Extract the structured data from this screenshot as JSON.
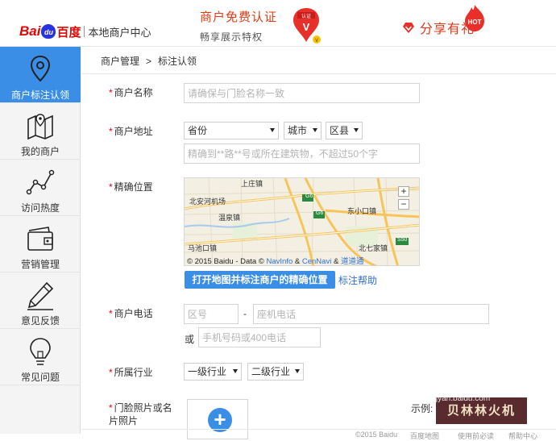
{
  "header": {
    "logo_bai": "Bai",
    "logo_du": "du",
    "logo_cn": "百度",
    "subtitle": "本地商户中心",
    "promo_line1": "商户免费认证",
    "promo_line2": "畅享展示特权",
    "promo_badge": "认证",
    "promo_badge_v": "V",
    "share_text": "分享有礼",
    "hot_badge": "HOT"
  },
  "sidebar": {
    "items": [
      {
        "label": "商户标注认领",
        "icon": "map-pin-icon",
        "active": true
      },
      {
        "label": "我的商户",
        "icon": "map-icon",
        "active": false
      },
      {
        "label": "访问热度",
        "icon": "line-chart-icon",
        "active": false
      },
      {
        "label": "营销管理",
        "icon": "wallet-icon",
        "active": false
      },
      {
        "label": "意见反馈",
        "icon": "pencil-icon",
        "active": false
      },
      {
        "label": "常见问题",
        "icon": "lightbulb-icon",
        "active": false
      }
    ]
  },
  "breadcrumb": {
    "root": "商户管理",
    "separator": ">",
    "current": "标注认领"
  },
  "form": {
    "name": {
      "label": "商户名称",
      "placeholder": "请确保与门脸名称一致"
    },
    "address": {
      "label": "商户地址",
      "province": "省份",
      "city": "城市",
      "district": "区县",
      "detail_placeholder": "精确到**路**号或所在建筑物，不超过50个字"
    },
    "location": {
      "label": "精确位置",
      "map_places": [
        "上庄镇",
        "北安河机场",
        "温泉镇",
        "东小口镇",
        "马池口镇",
        "北七家镇"
      ],
      "map_roads": [
        "G6",
        "G6",
        "S50"
      ],
      "map_copy_prefix": "© 2015 Baidu - Data ©",
      "map_copy_navinfo": "NavInfo",
      "map_copy_amp1": "&",
      "map_copy_cennavi": "CenNavi",
      "map_copy_amp2": "&",
      "map_copy_daodao": "道道通",
      "zoom_in": "+",
      "zoom_out": "−",
      "open_map_button": "打开地图并标注商户的精确位置",
      "help_link": "标注帮助"
    },
    "phone": {
      "label": "商户电话",
      "area_placeholder": "区号",
      "dash": "-",
      "landline_placeholder": "座机电话",
      "or": "或",
      "mobile_placeholder": "手机号码或400电话"
    },
    "industry": {
      "label": "所属行业",
      "level1": "一级行业",
      "level2": "二级行业"
    },
    "photo": {
      "label_line1": "门脸照片或名",
      "label_line2": "片照片",
      "add": "+",
      "example_label": "示例:",
      "example_text": "贝林林火机"
    }
  },
  "footer": {
    "copyright": "©2015 Baidu",
    "link1": "百度地图",
    "link2": "使用前必读",
    "link3": "帮助中心"
  },
  "watermark": {
    "brand": "Baidu",
    "text": "经验",
    "url": "ngyan.baidu.com"
  },
  "colors": {
    "accent": "#3a8ee6",
    "brand_red": "#e10601",
    "promo": "#e23a12",
    "required": "#e60012",
    "link": "#2f6fd6"
  }
}
